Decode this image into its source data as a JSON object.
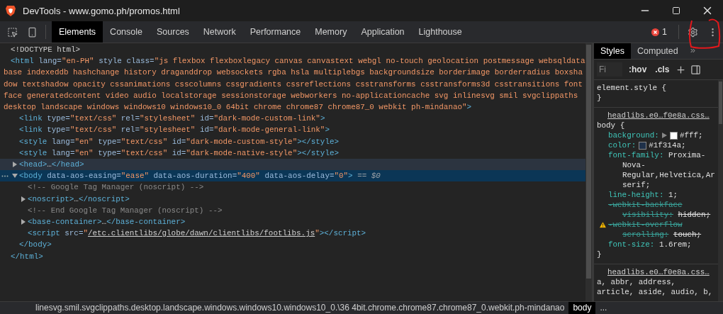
{
  "window": {
    "title": "DevTools - www.gomo.ph/promos.html"
  },
  "toolbar": {
    "tabs": [
      {
        "label": "Elements",
        "selected": true
      },
      {
        "label": "Console",
        "selected": false
      },
      {
        "label": "Sources",
        "selected": false
      },
      {
        "label": "Network",
        "selected": false
      },
      {
        "label": "Performance",
        "selected": false
      },
      {
        "label": "Memory",
        "selected": false
      },
      {
        "label": "Application",
        "selected": false
      },
      {
        "label": "Lighthouse",
        "selected": false
      }
    ],
    "error_count": "1"
  },
  "elements": {
    "selected_marker": "== $0",
    "nodes": [
      {
        "tokens": [
          {
            "kind": "plain",
            "text": "<!DOCTYPE html>"
          }
        ]
      },
      {
        "tokens": [
          {
            "kind": "tag",
            "text": "<html"
          },
          {
            "kind": "attr",
            "text": " lang="
          },
          {
            "kind": "value",
            "text": "\"en-PH\""
          },
          {
            "kind": "attr",
            "text": " style class="
          },
          {
            "kind": "value",
            "text": "\"js flexbox flexboxlegacy canvas canvastext webgl no-touch geolocation postmessage websqldatabase indexeddb hashchange history draganddrop websockets rgba hsla multiplebgs backgroundsize borderimage borderradius boxshadow textshadow opacity cssanimations csscolumns cssgradients cssreflections csstransforms csstransforms3d csstransitions fontface generatedcontent video audio localstorage sessionstorage webworkers no-applicationcache svg inlinesvg smil svgclippaths desktop landscape windows windows10 windows10_0 64bit chrome chrome87 chrome87_0 webkit ph-mindanao\""
          },
          {
            "kind": "tag",
            "text": ">"
          }
        ],
        "close": [
          {
            "kind": "tag",
            "text": "</html>"
          }
        ],
        "children": [
          {
            "tokens": [
              {
                "kind": "tag",
                "text": "<link"
              },
              {
                "kind": "attr",
                "text": " type="
              },
              {
                "kind": "value",
                "text": "\"text/css\""
              },
              {
                "kind": "attr",
                "text": " rel="
              },
              {
                "kind": "value",
                "text": "\"stylesheet\""
              },
              {
                "kind": "attr",
                "text": " id="
              },
              {
                "kind": "value",
                "text": "\"dark-mode-custom-link\""
              },
              {
                "kind": "tag",
                "text": ">"
              }
            ]
          },
          {
            "tokens": [
              {
                "kind": "tag",
                "text": "<link"
              },
              {
                "kind": "attr",
                "text": " type="
              },
              {
                "kind": "value",
                "text": "\"text/css\""
              },
              {
                "kind": "attr",
                "text": " rel="
              },
              {
                "kind": "value",
                "text": "\"stylesheet\""
              },
              {
                "kind": "attr",
                "text": " id="
              },
              {
                "kind": "value",
                "text": "\"dark-mode-general-link\""
              },
              {
                "kind": "tag",
                "text": ">"
              }
            ]
          },
          {
            "tokens": [
              {
                "kind": "tag",
                "text": "<style"
              },
              {
                "kind": "attr",
                "text": " lang="
              },
              {
                "kind": "value",
                "text": "\"en\""
              },
              {
                "kind": "attr",
                "text": " type="
              },
              {
                "kind": "value",
                "text": "\"text/css\""
              },
              {
                "kind": "attr",
                "text": " id="
              },
              {
                "kind": "value",
                "text": "\"dark-mode-custom-style\""
              },
              {
                "kind": "tag",
                "text": "></style>"
              }
            ]
          },
          {
            "tokens": [
              {
                "kind": "tag",
                "text": "<style"
              },
              {
                "kind": "attr",
                "text": " lang="
              },
              {
                "kind": "value",
                "text": "\"en\""
              },
              {
                "kind": "attr",
                "text": " type="
              },
              {
                "kind": "value",
                "text": "\"text/css\""
              },
              {
                "kind": "attr",
                "text": " id="
              },
              {
                "kind": "value",
                "text": "\"dark-mode-native-style\""
              },
              {
                "kind": "tag",
                "text": "></style>"
              }
            ]
          },
          {
            "tokens": [
              {
                "kind": "tag",
                "text": "<head>"
              },
              {
                "kind": "plain",
                "text": "…"
              },
              {
                "kind": "tag",
                "text": "</head>"
              }
            ],
            "expanded": false,
            "hovered": true,
            "selected": false
          },
          {
            "tokens": [
              {
                "kind": "tag",
                "text": "<body"
              },
              {
                "kind": "attr",
                "text": " data-aos-easing="
              },
              {
                "kind": "value",
                "text": "\"ease\""
              },
              {
                "kind": "attr",
                "text": " data-aos-duration="
              },
              {
                "kind": "value",
                "text": "\"400\""
              },
              {
                "kind": "attr",
                "text": " data-aos-delay="
              },
              {
                "kind": "value",
                "text": "\"0\""
              },
              {
                "kind": "tag",
                "text": ">"
              }
            ],
            "expanded": true,
            "hovered": false,
            "selected": true,
            "close": [
              {
                "kind": "tag",
                "text": "</body>"
              }
            ],
            "children": [
              {
                "tokens": [
                  {
                    "kind": "comment",
                    "text": "<!-- Google Tag Manager (noscript) -->"
                  }
                ]
              },
              {
                "tokens": [
                  {
                    "kind": "tag",
                    "text": "<noscript>"
                  },
                  {
                    "kind": "plain",
                    "text": "…"
                  },
                  {
                    "kind": "tag",
                    "text": "</noscript>"
                  }
                ],
                "expanded": false
              },
              {
                "tokens": [
                  {
                    "kind": "comment",
                    "text": "<!-- End Google Tag Manager (noscript) -->"
                  }
                ]
              },
              {
                "tokens": [
                  {
                    "kind": "tag",
                    "text": "<base-container>"
                  },
                  {
                    "kind": "plain",
                    "text": "…"
                  },
                  {
                    "kind": "tag",
                    "text": "</base-container>"
                  }
                ],
                "expanded": false
              },
              {
                "tokens": [
                  {
                    "kind": "tag",
                    "text": "<script"
                  },
                  {
                    "kind": "attr",
                    "text": " src="
                  },
                  {
                    "kind": "value",
                    "text": "\""
                  },
                  {
                    "kind": "link",
                    "text": "/etc.clientlibs/globe/dawn/clientlibs/footlibs.js"
                  },
                  {
                    "kind": "value",
                    "text": "\""
                  },
                  {
                    "kind": "tag",
                    "text": "></script>"
                  }
                ]
              }
            ]
          }
        ]
      }
    ]
  },
  "breadcrumb": {
    "items": [
      {
        "label": "linesvg.smil.svgclippaths.desktop.landscape.windows.windows10.windows10_0.\\36 4bit.chrome.chrome87.chrome87_0.webkit.ph-mindanao",
        "selected": false
      },
      {
        "label": "body",
        "selected": true
      }
    ],
    "more": "..."
  },
  "styles": {
    "tabs": [
      {
        "label": "Styles",
        "selected": true
      },
      {
        "label": "Computed",
        "selected": false
      }
    ],
    "more_tabs": "»",
    "filter": {
      "placeholder": "Fi"
    },
    "hov": ":hov",
    "cls": ".cls",
    "rules": [
      {
        "selector_lines": [
          "element.style {"
        ],
        "close": "}"
      },
      {
        "source": "headlibs.e0…f0e8a.css…",
        "selector_lines": [
          "body {"
        ],
        "close": "}",
        "decls": [
          {
            "name_lines": [
              "background:"
            ],
            "value_lines": [
              "#fff;"
            ],
            "expander": true,
            "color": "#ffffff",
            "struck": false,
            "warning": false
          },
          {
            "name_lines": [
              "color:"
            ],
            "value_lines": [
              "#1f314a;"
            ],
            "expander": false,
            "color": "#1f314a",
            "struck": false,
            "warning": false
          },
          {
            "name_lines": [
              "font-family:"
            ],
            "value_lines": [
              "Proxima-",
              "Nova-",
              "Regular,Helvetica,Ar",
              "serif;"
            ],
            "expander": false,
            "struck": false,
            "warning": false
          },
          {
            "name_lines": [
              "line-height:"
            ],
            "value_lines": [
              "1;"
            ],
            "expander": false,
            "struck": false,
            "warning": false
          },
          {
            "name_lines": [
              "-webkit-backface",
              "visibility:"
            ],
            "value_lines": [
              "hidden;"
            ],
            "expander": false,
            "struck": true,
            "warning": false
          },
          {
            "name_lines": [
              "-webkit-overflow",
              "scrolling:"
            ],
            "value_lines": [
              "touch;"
            ],
            "expander": false,
            "struck": true,
            "warning": true
          },
          {
            "name_lines": [
              "font-size:"
            ],
            "value_lines": [
              "1.6rem;"
            ],
            "expander": false,
            "struck": false,
            "warning": false
          }
        ]
      },
      {
        "source": "headlibs.e0…f0e8a.css…",
        "selector_lines": [
          "a, abbr, address,",
          "article, aside, audio, b,"
        ]
      }
    ]
  }
}
